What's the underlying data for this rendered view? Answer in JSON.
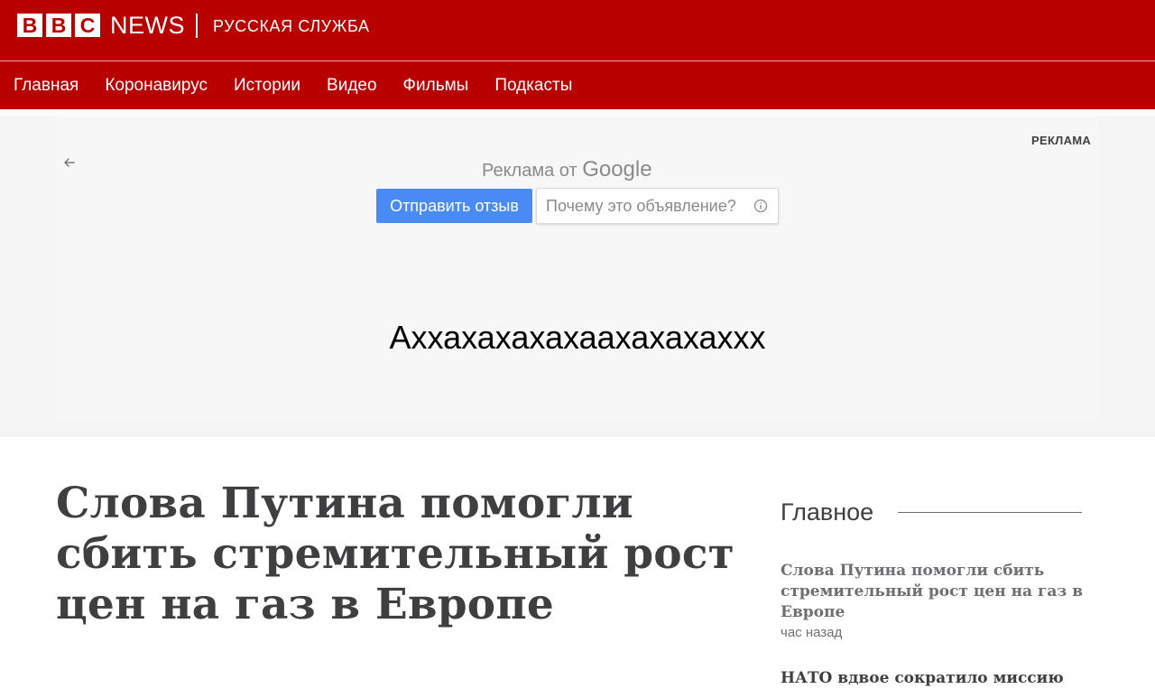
{
  "masthead": {
    "logo_letters": [
      "B",
      "B",
      "C"
    ],
    "news_label": "NEWS",
    "service_name": "РУССКАЯ СЛУЖБА",
    "background_color": "#b80000"
  },
  "nav": {
    "items": [
      {
        "label": "Главная"
      },
      {
        "label": "Коронавирус"
      },
      {
        "label": "Истории"
      },
      {
        "label": "Видео"
      },
      {
        "label": "Фильмы"
      },
      {
        "label": "Подкасты"
      }
    ]
  },
  "ad": {
    "label": "РЕКЛАМА",
    "ads_by": "Реклама от",
    "google_word": "Google",
    "feedback_button": "Отправить отзыв",
    "why_button": "Почему это объявление?",
    "message": "Аххахахахахаахахахаххх",
    "back_icon": "arrow-left-icon",
    "info_icon": "info-circle-icon",
    "accent_color": "#4a8af4"
  },
  "article": {
    "headline": "Слова Путина помогли сбить стремительный рост цен на газ в Европе"
  },
  "sidebar": {
    "title": "Главное",
    "stories": [
      {
        "title": "Слова Путина помогли сбить стремительный рост цен на газ в Европе",
        "time": "час назад"
      },
      {
        "title": "НАТО вдвое сократило миссию"
      }
    ]
  }
}
